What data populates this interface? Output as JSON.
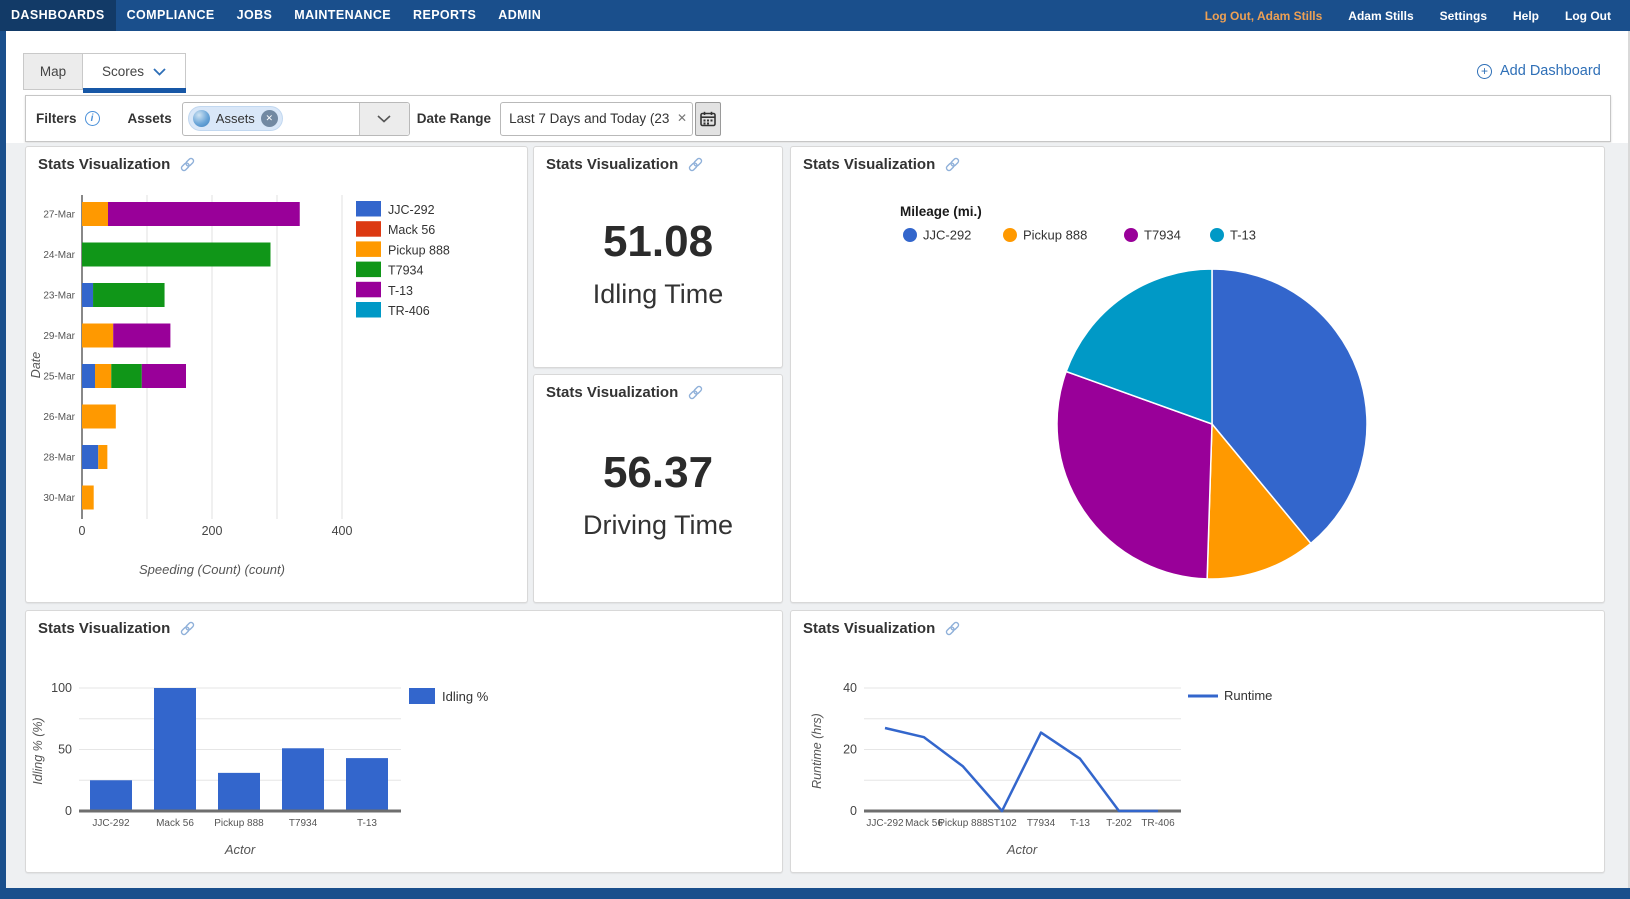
{
  "nav": {
    "items": [
      "DASHBOARDS",
      "COMPLIANCE",
      "JOBS",
      "MAINTENANCE",
      "REPORTS",
      "ADMIN"
    ],
    "active_item": "DASHBOARDS",
    "logout_user_link": "Log Out, Adam Stills",
    "user_name": "Adam Stills",
    "settings_label": "Settings",
    "help_label": "Help",
    "logout_label": "Log Out"
  },
  "tabs": {
    "map_label": "Map",
    "scores_label": "Scores",
    "add_dashboard_label": "Add Dashboard"
  },
  "filters": {
    "filters_label": "Filters",
    "assets_label": "Assets",
    "assets_chip_label": "Assets",
    "date_range_label": "Date Range",
    "date_range_value": "Last 7 Days and Today (23"
  },
  "panels": {
    "title": "Stats Visualization"
  },
  "colors": {
    "navbar": "#1a4f8c",
    "navbar_active": "#123a67",
    "accent_orange": "#eda054",
    "link_blue": "#2e6fb7",
    "tab_underline": "#1757a6",
    "dashboard_bg": "#eef0f2",
    "palette": [
      "#3366CC",
      "#DC3912",
      "#FF9900",
      "#109618",
      "#990099",
      "#0099C6"
    ]
  },
  "chart_data": [
    {
      "type": "bar",
      "orientation": "horizontal",
      "stacked": true,
      "xlabel": "Speeding (Count) (count)",
      "ylabel": "Date",
      "xlim": [
        0,
        430
      ],
      "xticks": [
        0,
        200,
        400
      ],
      "gridlines_every": 100,
      "legend_position": "right",
      "categories": [
        "27-Mar",
        "24-Mar",
        "23-Mar",
        "29-Mar",
        "25-Mar",
        "26-Mar",
        "28-Mar",
        "30-Mar"
      ],
      "series": [
        {
          "name": "JJC-292",
          "color": "#3366CC",
          "values": [
            0,
            0,
            17,
            0,
            20,
            0,
            25,
            0
          ]
        },
        {
          "name": "Mack 56",
          "color": "#DC3912",
          "values": [
            0,
            0,
            0,
            0,
            0,
            0,
            0,
            0
          ]
        },
        {
          "name": "Pickup 888",
          "color": "#FF9900",
          "values": [
            40,
            0,
            0,
            48,
            25,
            52,
            14,
            18
          ]
        },
        {
          "name": "T7934",
          "color": "#109618",
          "values": [
            0,
            290,
            110,
            0,
            47,
            0,
            0,
            0
          ]
        },
        {
          "name": "T-13",
          "color": "#990099",
          "values": [
            295,
            0,
            0,
            88,
            68,
            0,
            0,
            0
          ]
        },
        {
          "name": "TR-406",
          "color": "#0099C6",
          "values": [
            0,
            0,
            0,
            0,
            0,
            0,
            0,
            0
          ]
        }
      ]
    },
    {
      "type": "stat",
      "value": "51.08",
      "label": "Idling Time"
    },
    {
      "type": "stat",
      "value": "56.37",
      "label": "Driving Time"
    },
    {
      "type": "pie",
      "title": "Mileage (mi.)",
      "legend_position": "top",
      "series": [
        {
          "name": "JJC-292",
          "color": "#3366CC",
          "percent": 39
        },
        {
          "name": "Pickup 888",
          "color": "#FF9900",
          "percent": 11.5
        },
        {
          "name": "T7934",
          "color": "#990099",
          "percent": 30
        },
        {
          "name": "T-13",
          "color": "#0099C6",
          "percent": 19.5
        }
      ]
    },
    {
      "type": "bar",
      "orientation": "vertical",
      "xlabel": "Actor",
      "ylabel": "Idling % (%)",
      "ylim": [
        0,
        100
      ],
      "yticks": [
        0,
        50,
        100
      ],
      "gridlines_every": 25,
      "legend_position": "right",
      "categories": [
        "JJC-292",
        "Mack 56",
        "Pickup 888",
        "T7934",
        "T-13"
      ],
      "series": [
        {
          "name": "Idling %",
          "color": "#3366CC",
          "values": [
            25,
            100,
            31,
            51,
            43
          ]
        }
      ]
    },
    {
      "type": "line",
      "xlabel": "Actor",
      "ylabel": "Runtime (hrs)",
      "ylim": [
        0,
        40
      ],
      "yticks": [
        0,
        20,
        40
      ],
      "gridlines_every": 10,
      "legend_position": "right",
      "categories": [
        "JJC-292",
        "Mack 56",
        "Pickup 888",
        "ST102",
        "T7934",
        "T-13",
        "T-202",
        "TR-406"
      ],
      "series": [
        {
          "name": "Runtime",
          "color": "#3366CC",
          "values": [
            27,
            24,
            14.5,
            0,
            25.5,
            17,
            0,
            0
          ]
        }
      ]
    }
  ]
}
